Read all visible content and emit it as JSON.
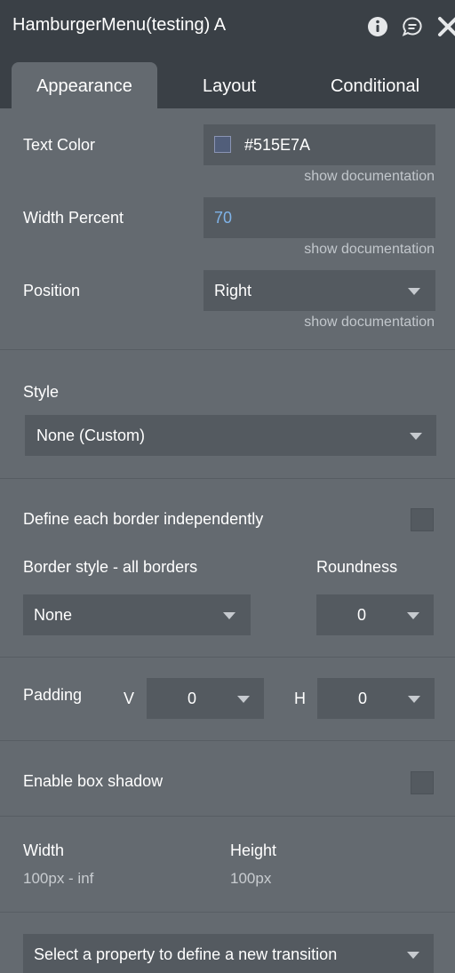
{
  "header": {
    "title": "HamburgerMenu(testing) A",
    "icons": [
      "info-icon",
      "comment-icon",
      "close-icon"
    ]
  },
  "tabs": [
    {
      "label": "Appearance",
      "active": true
    },
    {
      "label": "Layout",
      "active": false
    },
    {
      "label": "Conditional",
      "active": false
    }
  ],
  "doc_link": "show documentation",
  "text_color": {
    "label": "Text Color",
    "value": "#515E7A",
    "swatch": "#515E7A"
  },
  "width_percent": {
    "label": "Width Percent",
    "value": "70",
    "value_color": "#7fb3e8"
  },
  "position": {
    "label": "Position",
    "value": "Right"
  },
  "style": {
    "label": "Style",
    "value": "None (Custom)"
  },
  "border": {
    "define_label": "Define each border independently",
    "style_label": "Border style - all borders",
    "style_value": "None",
    "roundness_label": "Roundness",
    "roundness_value": "0"
  },
  "padding": {
    "label": "Padding",
    "v_label": "V",
    "v_value": "0",
    "h_label": "H",
    "h_value": "0"
  },
  "shadow": {
    "label": "Enable box shadow"
  },
  "size": {
    "width_label": "Width",
    "width_value": "100px - inf",
    "height_label": "Height",
    "height_value": "100px"
  },
  "transition": {
    "placeholder": "Select a property to define a new transition"
  }
}
